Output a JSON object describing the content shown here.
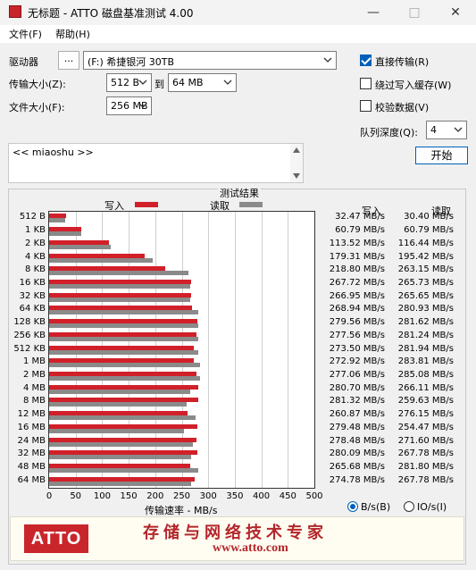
{
  "window": {
    "title": "无标题 - ATTO 磁盘基准测试 4.00"
  },
  "menu": [
    "文件(F)",
    "帮助(H)"
  ],
  "controls": {
    "drive_label": "驱动器",
    "browse_label": "...",
    "drive_value": "(F:) 希捷银河 30TB",
    "transfer_label": "传输大小(Z):",
    "transfer_from": "512 B",
    "to_label": "到",
    "transfer_to": "64 MB",
    "file_size_label": "文件大小(F):",
    "file_size": "256 MB",
    "direct_io": "直接传输(R)",
    "bypass_cache": "绕过写入缓存(W)",
    "verify_data": "校验数据(V)",
    "queue_depth_label": "队列深度(Q):",
    "queue_depth": "4",
    "start_label": "开始",
    "description": "<< miaoshu >>",
    "direct_io_checked": true,
    "bypass_cache_checked": false,
    "verify_data_checked": false
  },
  "results": {
    "title": "测试结果",
    "legend_write": "写入",
    "legend_read": "读取",
    "col_write": "写入",
    "col_read": "读取",
    "x_axis_label": "传输速率 - MB/s",
    "unit_bs": "B/s(B)",
    "unit_ios": "IO/s(I)",
    "unit_selected": "B/s"
  },
  "chart_data": {
    "type": "bar",
    "orientation": "horizontal",
    "xlabel": "传输速率 - MB/s",
    "xlim": [
      0,
      500
    ],
    "xticks": [
      0,
      50,
      100,
      150,
      200,
      250,
      300,
      350,
      400,
      450,
      500
    ],
    "grid": true,
    "legend": "top",
    "categories": [
      "512 B",
      "1 KB",
      "2 KB",
      "4 KB",
      "8 KB",
      "16 KB",
      "32 KB",
      "64 KB",
      "128 KB",
      "256 KB",
      "512 KB",
      "1 MB",
      "2 MB",
      "4 MB",
      "8 MB",
      "12 MB",
      "16 MB",
      "24 MB",
      "32 MB",
      "48 MB",
      "64 MB"
    ],
    "series": [
      {
        "name": "写入",
        "color": "#d12029",
        "values": [
          32.47,
          60.79,
          113.52,
          179.31,
          218.8,
          267.72,
          266.95,
          268.94,
          279.56,
          277.56,
          273.5,
          272.92,
          277.06,
          280.7,
          281.32,
          260.87,
          279.48,
          278.48,
          280.09,
          265.68,
          274.78
        ],
        "labels": [
          "32.47 MB/s",
          "60.79 MB/s",
          "113.52 MB/s",
          "179.31 MB/s",
          "218.80 MB/s",
          "267.72 MB/s",
          "266.95 MB/s",
          "268.94 MB/s",
          "279.56 MB/s",
          "277.56 MB/s",
          "273.50 MB/s",
          "272.92 MB/s",
          "277.06 MB/s",
          "280.70 MB/s",
          "281.32 MB/s",
          "260.87 MB/s",
          "279.48 MB/s",
          "278.48 MB/s",
          "280.09 MB/s",
          "265.68 MB/s",
          "274.78 MB/s"
        ]
      },
      {
        "name": "读取",
        "color": "#8a8a8a",
        "values": [
          30.4,
          60.79,
          116.44,
          195.42,
          263.15,
          265.73,
          265.65,
          280.93,
          281.62,
          281.24,
          281.94,
          283.81,
          285.08,
          266.11,
          259.63,
          276.15,
          254.47,
          271.6,
          267.78,
          281.8,
          267.78
        ],
        "labels": [
          "30.40 MB/s",
          "60.79 MB/s",
          "116.44 MB/s",
          "195.42 MB/s",
          "263.15 MB/s",
          "265.73 MB/s",
          "265.65 MB/s",
          "280.93 MB/s",
          "281.62 MB/s",
          "281.24 MB/s",
          "281.94 MB/s",
          "283.81 MB/s",
          "285.08 MB/s",
          "266.11 MB/s",
          "259.63 MB/s",
          "276.15 MB/s",
          "254.47 MB/s",
          "271.60 MB/s",
          "267.78 MB/s",
          "281.80 MB/s",
          "267.78 MB/s"
        ]
      }
    ]
  },
  "banner": {
    "logo": "ATTO",
    "slogan": "存储与网络技术专家",
    "url": "www.atto.com"
  }
}
